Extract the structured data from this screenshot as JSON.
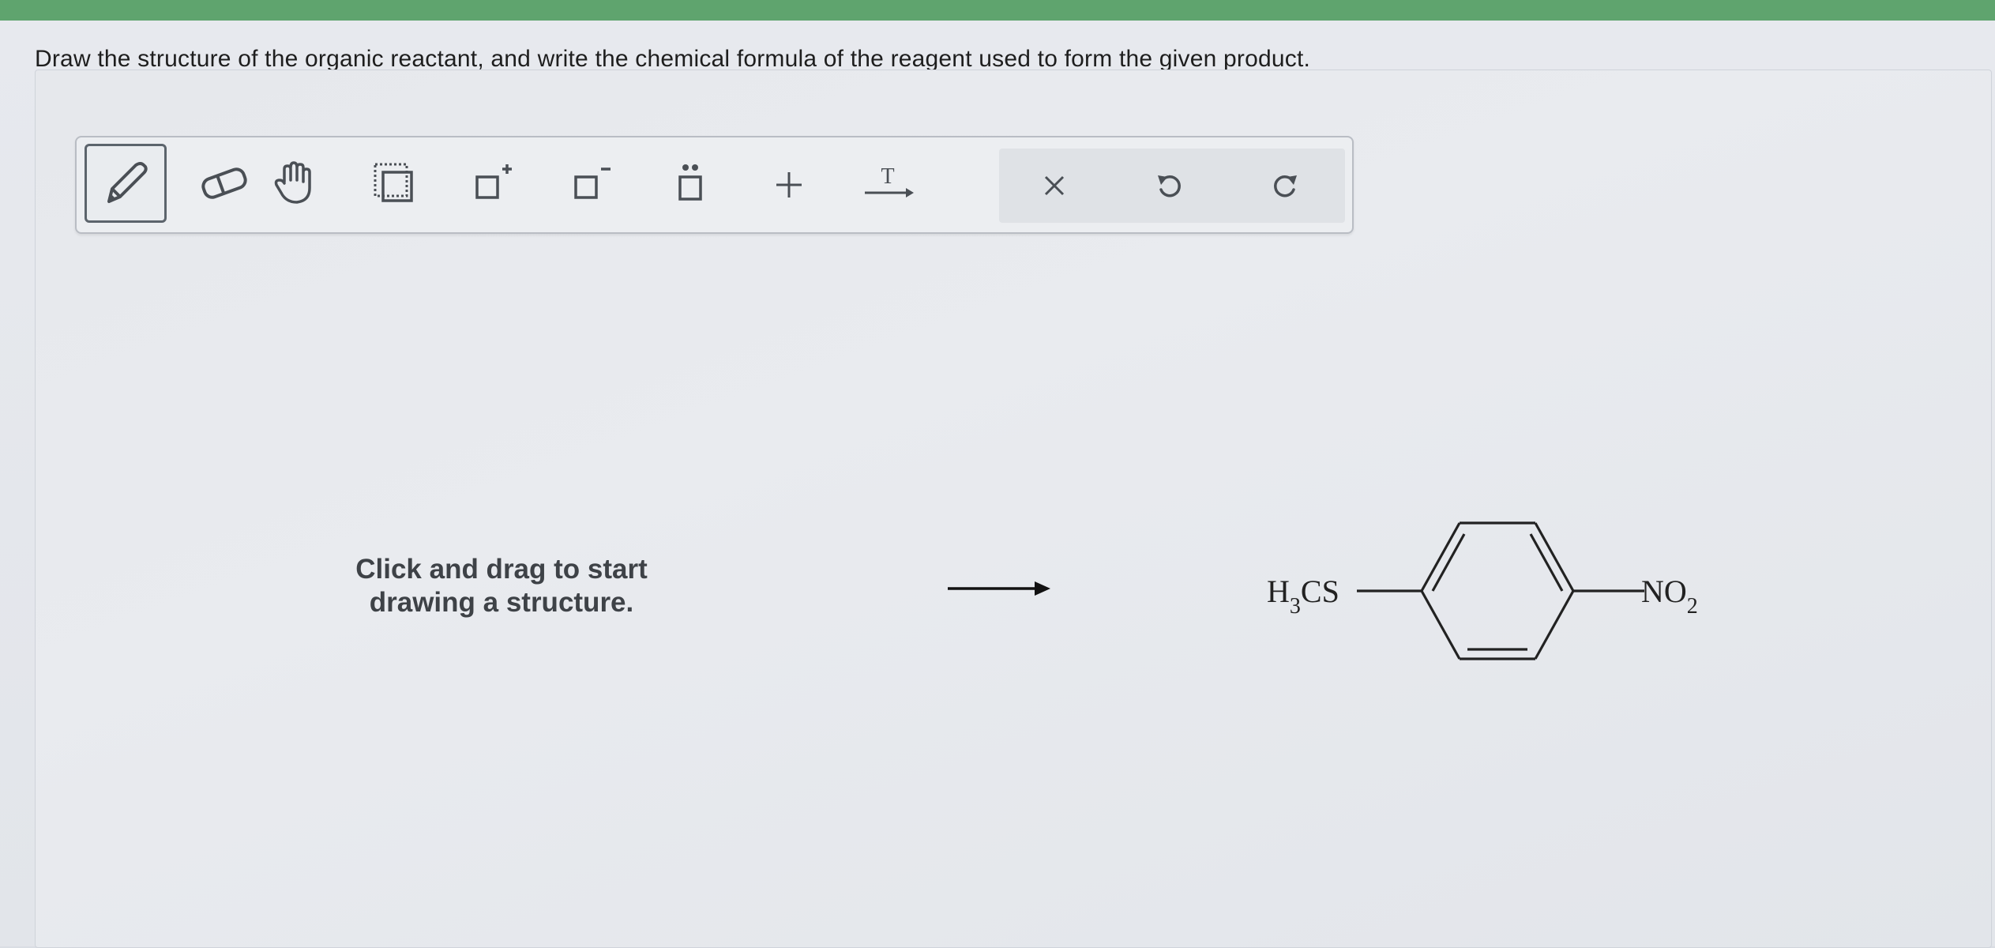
{
  "question": {
    "text": "Draw the structure of the organic reactant, and write the chemical formula of the reagent used to form the given product."
  },
  "toolbar": {
    "tools": [
      {
        "name": "pencil-icon",
        "active": true
      },
      {
        "name": "eraser-icon",
        "active": false
      },
      {
        "name": "hand-icon",
        "active": false
      },
      {
        "name": "select-box-icon",
        "active": false
      },
      {
        "name": "positive-charge-icon",
        "active": false
      },
      {
        "name": "negative-charge-icon",
        "active": false
      },
      {
        "name": "lone-pair-icon",
        "active": false
      },
      {
        "name": "plus-icon",
        "active": false
      },
      {
        "name": "text-arrow-icon",
        "active": false
      }
    ],
    "text_tool_glyph": "T",
    "actions": [
      {
        "name": "clear-icon"
      },
      {
        "name": "undo-icon"
      },
      {
        "name": "redo-icon"
      }
    ]
  },
  "canvas": {
    "hint_line1": "Click and drag to start",
    "hint_line2": "drawing a structure."
  },
  "product": {
    "left_group_main": "H",
    "left_group_sub": "3",
    "left_group_rest": "CS",
    "right_group_main": "NO",
    "right_group_sub": "2"
  },
  "colors": {
    "top_bar": "#5fa46e",
    "toolbar_border": "#b9bdc4",
    "icon": "#4a4f55",
    "text": "#1e1e1e"
  }
}
